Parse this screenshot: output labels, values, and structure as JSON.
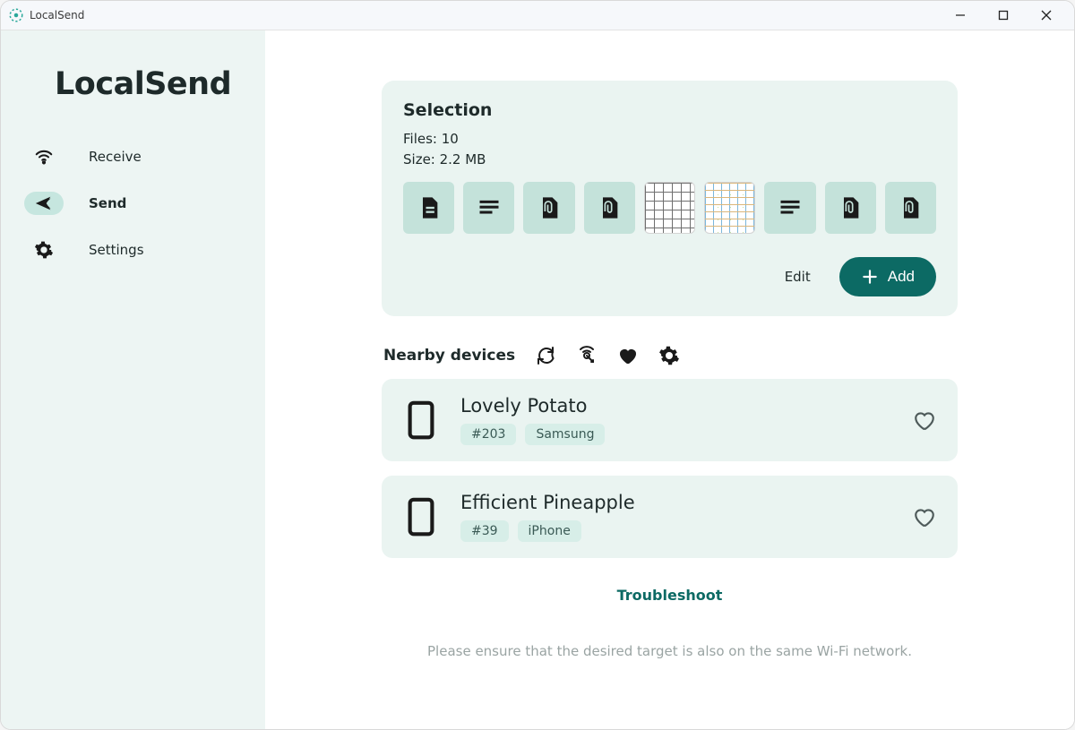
{
  "titlebar": {
    "title": "LocalSend"
  },
  "brand": "LocalSend",
  "nav": {
    "receive": "Receive",
    "send": "Send",
    "settings": "Settings"
  },
  "selection": {
    "title": "Selection",
    "files_line": "Files: 10",
    "size_line": "Size: 2.2 MB",
    "edit": "Edit",
    "add": "Add",
    "thumbs": [
      {
        "kind": "doc"
      },
      {
        "kind": "text"
      },
      {
        "kind": "attach"
      },
      {
        "kind": "attach"
      },
      {
        "kind": "image-bw"
      },
      {
        "kind": "image-color"
      },
      {
        "kind": "text"
      },
      {
        "kind": "attach"
      },
      {
        "kind": "attach"
      }
    ]
  },
  "nearby": {
    "title": "Nearby devices"
  },
  "devices": [
    {
      "name": "Lovely Potato",
      "code": "#203",
      "platform": "Samsung"
    },
    {
      "name": "Efficient Pineapple",
      "code": "#39",
      "platform": "iPhone"
    }
  ],
  "troubleshoot": "Troubleshoot",
  "hint": "Please ensure that the desired target is also on the same Wi-Fi network."
}
